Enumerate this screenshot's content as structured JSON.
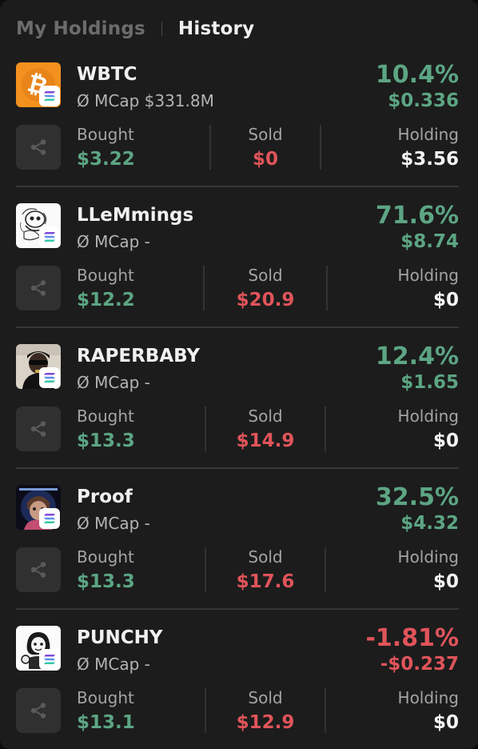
{
  "colors": {
    "background": "#1c1c1c",
    "positive": "#5ca583",
    "negative": "#e0545a",
    "text_primary": "#f0f0f0",
    "text_muted": "#a4a4a4",
    "divider": "#363636"
  },
  "tabs": [
    {
      "label": "My Holdings",
      "active": false
    },
    {
      "label": "History",
      "active": true
    }
  ],
  "labels": {
    "bought": "Bought",
    "sold": "Sold",
    "holding": "Holding"
  },
  "icons": {
    "share": "share-icon",
    "chain_badge": "solana-icon"
  },
  "holdings": [
    {
      "name": "WBTC",
      "avatar_icon": "bitcoin-logo",
      "mcap": "Ø MCap $331.8M",
      "pnl_percent": "10.4%",
      "pnl_usd": "$0.336",
      "pnl_positive": true,
      "bought": "$3.22",
      "sold": "$0",
      "holding": "$3.56"
    },
    {
      "name": "LLeMmings",
      "avatar_icon": "llemmings-sketch-avatar",
      "mcap": "Ø MCap -",
      "pnl_percent": "71.6%",
      "pnl_usd": "$8.74",
      "pnl_positive": true,
      "bought": "$12.2",
      "sold": "$20.9",
      "holding": "$0"
    },
    {
      "name": "RAPERBABY",
      "avatar_icon": "rapper-photo-avatar",
      "mcap": "Ø MCap -",
      "pnl_percent": "12.4%",
      "pnl_usd": "$1.65",
      "pnl_positive": true,
      "bought": "$13.3",
      "sold": "$14.9",
      "holding": "$0"
    },
    {
      "name": "Proof",
      "avatar_icon": "proof-art-avatar",
      "mcap": "Ø MCap -",
      "pnl_percent": "32.5%",
      "pnl_usd": "$4.32",
      "pnl_positive": true,
      "bought": "$13.3",
      "sold": "$17.6",
      "holding": "$0"
    },
    {
      "name": "PUNCHY",
      "avatar_icon": "punchy-cartoon-avatar",
      "mcap": "Ø MCap -",
      "pnl_percent": "-1.81%",
      "pnl_usd": "-$0.237",
      "pnl_positive": false,
      "bought": "$13.1",
      "sold": "$12.9",
      "holding": "$0"
    }
  ]
}
